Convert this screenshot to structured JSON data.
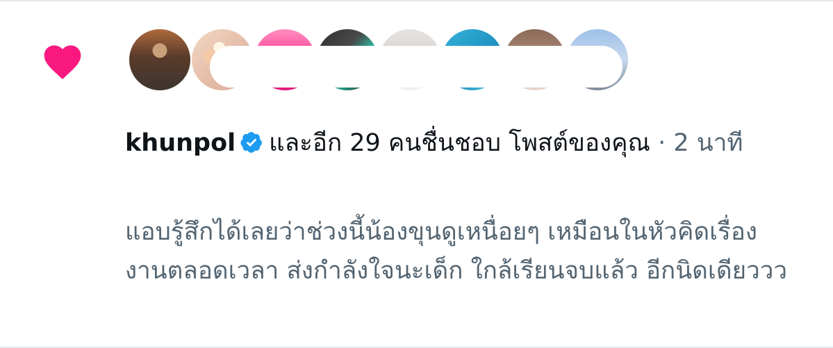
{
  "notification": {
    "icon": "heart-icon",
    "accent_color": "#f91880",
    "verified_color": "#1d9bf0",
    "username": "khunpol",
    "action_text": "และอีก 29 คนชื่นชอบ โพสต์ของคุณ",
    "separator": "·",
    "time_ago": "2 นาที",
    "avatars_count": 8
  },
  "post": {
    "text": "แอบรู้สึกได้เลยว่าช่วงนี้น้องขุนดูเหนื่อยๆ เหมือนในหัวคิดเรื่องงานตลอดเวลา ส่งกำลังใจนะเด็ก ใกล้เรียนจบแล้ว อีกนิดเดียววว"
  }
}
